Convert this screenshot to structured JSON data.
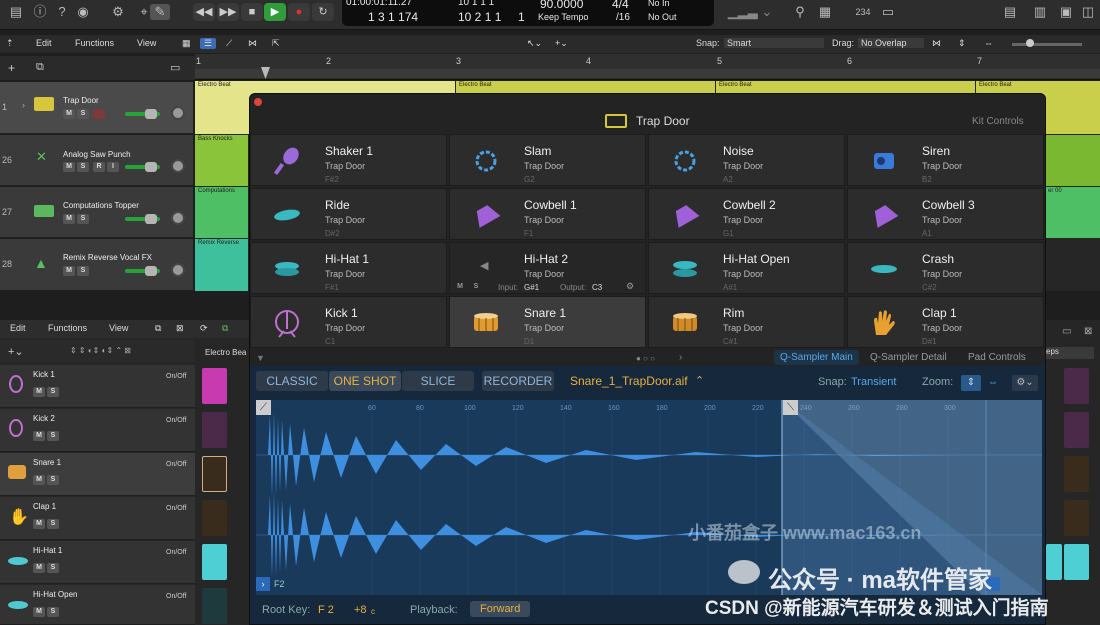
{
  "lcd": {
    "position": "01:00:01:11.27",
    "bars": "1  3  1  174",
    "pos_beat": "10  1  1  1",
    "pos_beat2": "10  2  1  1",
    "beat_right": "1",
    "tempo": "90.0000",
    "tempo_mode": "Keep Tempo",
    "time_sig": "4/4",
    "division": "/16",
    "in_label": "No In",
    "out_label": "No Out",
    "counter": "234"
  },
  "arrange_menu": {
    "edit": "Edit",
    "functions": "Functions",
    "view": "View",
    "snap_label": "Snap:",
    "snap_value": "Smart",
    "drag_label": "Drag:",
    "drag_value": "No Overlap"
  },
  "ruler": [
    "1",
    "2",
    "3",
    "4",
    "5",
    "6",
    "7"
  ],
  "tracks": [
    {
      "num": "1",
      "name": "Trap Door"
    },
    {
      "num": "26",
      "name": "Analog Saw Punch"
    },
    {
      "num": "27",
      "name": "Computations Topper"
    },
    {
      "num": "28",
      "name": "Remix Reverse Vocal FX"
    }
  ],
  "track_buttons": {
    "m": "M",
    "s": "S",
    "r": "R",
    "i": "I"
  },
  "regions": {
    "electro": "Electro Beat",
    "bass": "Bass Knocks",
    "computations": "Computations",
    "remix": "Remix Reverse",
    "right_label": "er 00"
  },
  "lower_menu": {
    "edit": "Edit",
    "functions": "Functions",
    "view": "View",
    "region_label": "Electro Bea",
    "steps": "eps"
  },
  "drum_tracks": [
    {
      "name": "Kick 1",
      "state": "On/Off"
    },
    {
      "name": "Kick 2",
      "state": "On/Off"
    },
    {
      "name": "Snare 1",
      "state": "On/Off"
    },
    {
      "name": "Clap 1",
      "state": "On/Off"
    },
    {
      "name": "Hi-Hat 1",
      "state": "On/Off"
    },
    {
      "name": "Hi-Hat Open",
      "state": "On/Off"
    }
  ],
  "plugin": {
    "title": "Trap Door",
    "kit_controls": "Kit Controls",
    "pads": [
      {
        "name": "Shaker 1",
        "kit": "Trap Door",
        "note": "F#2"
      },
      {
        "name": "Slam",
        "kit": "Trap Door",
        "note": "G2"
      },
      {
        "name": "Noise",
        "kit": "Trap Door",
        "note": "A2"
      },
      {
        "name": "Siren",
        "kit": "Trap Door",
        "note": "B2"
      },
      {
        "name": "Ride",
        "kit": "Trap Door",
        "note": "D#2"
      },
      {
        "name": "Cowbell 1",
        "kit": "Trap Door",
        "note": "F1"
      },
      {
        "name": "Cowbell 2",
        "kit": "Trap Door",
        "note": "G1"
      },
      {
        "name": "Cowbell 3",
        "kit": "Trap Door",
        "note": "A1"
      },
      {
        "name": "Hi-Hat 1",
        "kit": "Trap Door",
        "note": "F#1"
      },
      {
        "name": "Hi-Hat 2",
        "kit": "Trap Door",
        "note": ""
      },
      {
        "name": "Hi-Hat Open",
        "kit": "Trap Door",
        "note": "A#1"
      },
      {
        "name": "Crash",
        "kit": "Trap Door",
        "note": "C#2"
      },
      {
        "name": "Kick 1",
        "kit": "Trap Door",
        "note": "C1"
      },
      {
        "name": "Snare 1",
        "kit": "Trap Door",
        "note": "D1"
      },
      {
        "name": "Rim",
        "kit": "Trap Door",
        "note": "C#1"
      },
      {
        "name": "Clap 1",
        "kit": "Trap Door",
        "note": "D#1"
      }
    ],
    "hihat2_controls": {
      "m": "M",
      "s": "S",
      "input_label": "Input:",
      "input": "G#1",
      "output_label": "Output:",
      "output": "C3"
    },
    "tabs": {
      "main": "Q-Sampler Main",
      "detail": "Q-Sampler Detail",
      "pad": "Pad Controls"
    },
    "modes": {
      "classic": "CLASSIC",
      "oneshot": "ONE SHOT",
      "slice": "SLICE",
      "recorder": "RECORDER"
    },
    "file": "Snare_1_TrapDoor.aif",
    "snap_label": "Snap:",
    "snap_value": "Transient",
    "zoom_label": "Zoom:",
    "wave_ticks": [
      "60",
      "80",
      "100",
      "120",
      "140",
      "160",
      "180",
      "200",
      "220",
      "240",
      "260",
      "280",
      "300"
    ],
    "note_marker": "F2",
    "root_key_label": "Root Key:",
    "root_key": "F 2",
    "tune": "+8",
    "tune_unit": "c",
    "playback_label": "Playback:",
    "playback": "Forward"
  },
  "watermarks": {
    "mac": "小番茄盒子 www.mac163.cn",
    "wechat": "公众号 · ma软件管家",
    "csdn": "CSDN @新能源汽车研发＆测试入门指南"
  }
}
